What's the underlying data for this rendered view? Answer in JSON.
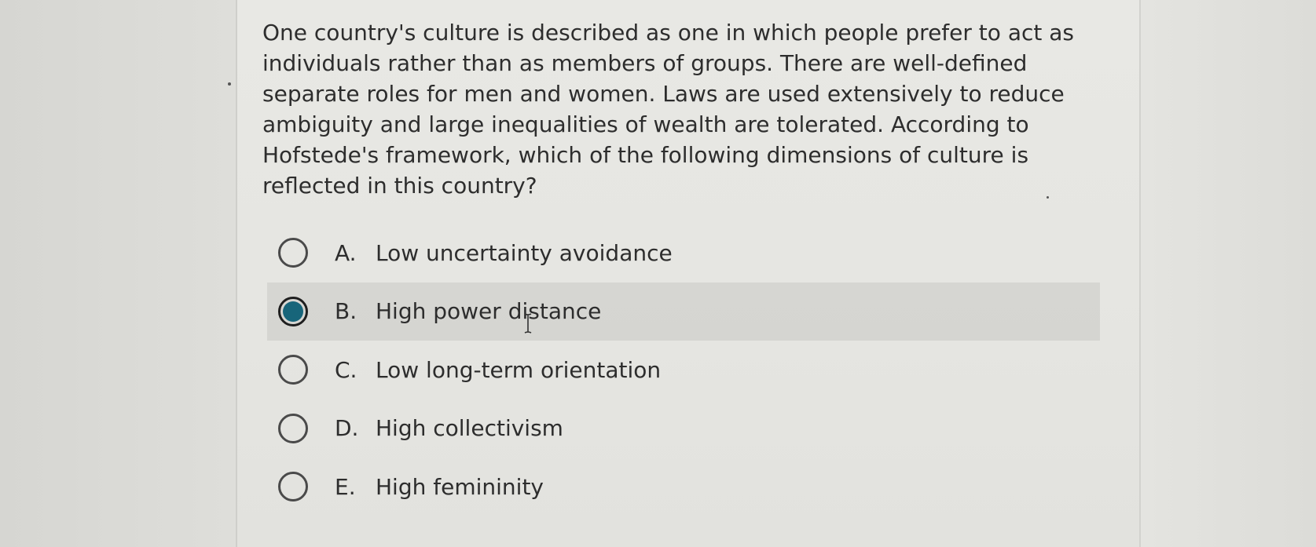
{
  "question": {
    "text": "One country's culture is described as one in which people prefer to act as individuals rather than as members of groups. There are well-defined separate roles for men and women. Laws are used extensively to reduce ambiguity and large inequalities of wealth are tolerated. According to Hofstede's framework, which of the following dimensions of culture is reflected in this country?"
  },
  "options": [
    {
      "letter": "A.",
      "label": "Low uncertainty avoidance",
      "selected": false
    },
    {
      "letter": "B.",
      "label": "High power distance",
      "selected": true
    },
    {
      "letter": "C.",
      "label": "Low long-term orientation",
      "selected": false
    },
    {
      "letter": "D.",
      "label": "High collectivism",
      "selected": false
    },
    {
      "letter": "E.",
      "label": "High femininity",
      "selected": false
    }
  ],
  "colors": {
    "selected_radio": "#17657a",
    "text": "#2d2d2d"
  },
  "icons": {
    "cursor": "text-cursor-icon"
  }
}
